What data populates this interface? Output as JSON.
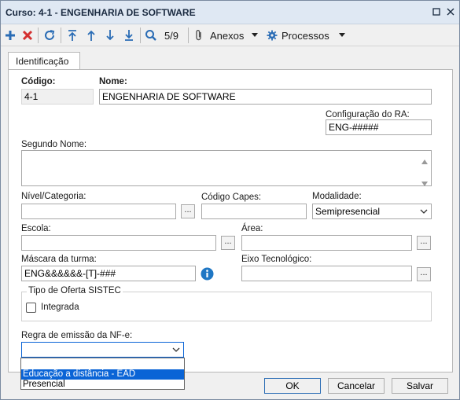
{
  "window": {
    "title": "Curso: 4-1 - ENGENHARIA DE SOFTWARE",
    "restore_icon": "restore-icon",
    "close_icon": "close-icon"
  },
  "toolbar": {
    "record_position": "5/9",
    "anexos_label": "Anexos",
    "processos_label": "Processos",
    "icons": [
      "add-icon",
      "delete-icon",
      "refresh-icon",
      "first-record-icon",
      "previous-record-icon",
      "next-record-icon",
      "last-record-icon",
      "search-icon",
      "paperclip-icon",
      "gear-icon"
    ]
  },
  "tabs": [
    {
      "label": "Identificação",
      "active": true
    }
  ],
  "form": {
    "codigo": {
      "label": "Código:",
      "value": "4-1"
    },
    "nome": {
      "label": "Nome:",
      "value": "ENGENHARIA DE SOFTWARE"
    },
    "config_ra": {
      "label": "Configuração do RA:",
      "value": "ENG-#####"
    },
    "segundo_nome": {
      "label": "Segundo Nome:",
      "value": ""
    },
    "nivel": {
      "label": "Nível/Categoria:",
      "value": ""
    },
    "codigo_capes": {
      "label": "Código Capes:",
      "value": ""
    },
    "modalidade": {
      "label": "Modalidade:",
      "value": "Semipresencial"
    },
    "escola": {
      "label": "Escola:",
      "value": ""
    },
    "area": {
      "label": "Área:",
      "value": ""
    },
    "mascara": {
      "label": "Máscara da turma:",
      "value": "ENG&&&&&&-[T]-###"
    },
    "eixo": {
      "label": "Eixo Tecnológico:",
      "value": ""
    },
    "sistec": {
      "label": "Tipo de Oferta SISTEC",
      "integrada_label": "Integrada",
      "integrada_checked": false
    },
    "regra_nfe": {
      "label": "Regra de emissão da NF-e:",
      "value": "",
      "options": [
        "",
        "Educação a distância - EAD",
        "Presencial"
      ],
      "highlighted_index": 1
    },
    "ellipsis": "..."
  },
  "footer": {
    "ok": "OK",
    "cancelar": "Cancelar",
    "salvar": "Salvar"
  },
  "colors": {
    "accent": "#2a6cb5",
    "delete": "#d43030",
    "selection": "#0a64d6",
    "info": "#1f77c4"
  }
}
